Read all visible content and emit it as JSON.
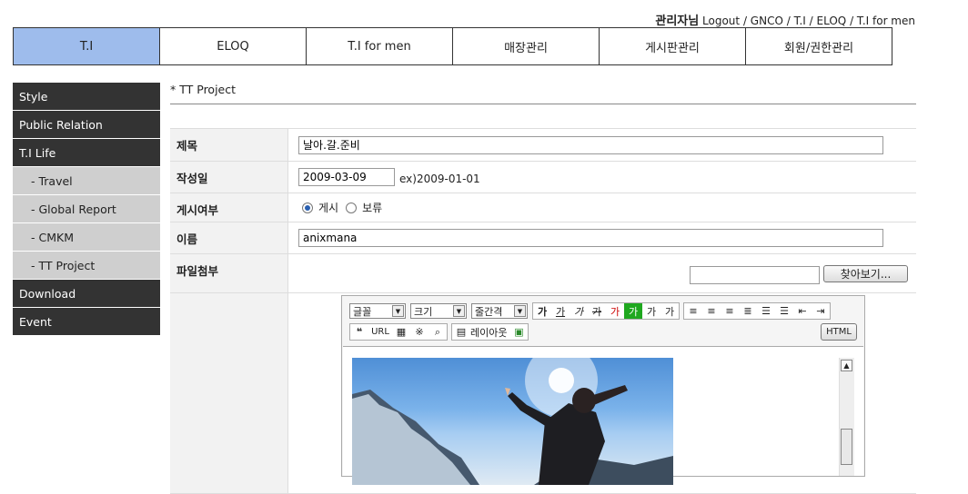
{
  "header": {
    "admin_label": "관리자님",
    "links": [
      "Logout",
      "GNCO",
      "T.I",
      "ELOQ",
      "T.I for men"
    ]
  },
  "tabs": [
    {
      "label": "T.I",
      "active": true
    },
    {
      "label": "ELOQ",
      "active": false
    },
    {
      "label": "T.I for men",
      "active": false
    },
    {
      "label": "매장관리",
      "active": false
    },
    {
      "label": "게시판관리",
      "active": false
    },
    {
      "label": "회원/권한관리",
      "active": false
    }
  ],
  "sidebar": {
    "items": [
      {
        "label": "Style",
        "type": "main"
      },
      {
        "label": "Public Relation",
        "type": "main"
      },
      {
        "label": "T.I Life",
        "type": "main"
      },
      {
        "label": "- Travel",
        "type": "sub"
      },
      {
        "label": "- Global Report",
        "type": "sub"
      },
      {
        "label": "- CMKM",
        "type": "sub"
      },
      {
        "label": "- TT Project",
        "type": "sub"
      },
      {
        "label": "Download",
        "type": "main"
      },
      {
        "label": "Event",
        "type": "main"
      }
    ]
  },
  "page": {
    "breadcrumb": "* TT Project"
  },
  "form": {
    "title_label": "제목",
    "title_value": "날아.갈.준비",
    "date_label": "작성일",
    "date_value": "2009-03-09",
    "date_hint": "ex)2009-01-01",
    "publish_label": "게시여부",
    "publish_on": "게시",
    "publish_off": "보류",
    "name_label": "이름",
    "name_value": "anixmana",
    "file_label": "파일첨부",
    "browse_label": "찾아보기..."
  },
  "editor": {
    "font_select": "글꼴",
    "size_select": "크기",
    "line_select": "줄간격",
    "format_buttons": [
      "가",
      "가",
      "가",
      "가",
      "가",
      "가",
      "가",
      "가"
    ],
    "url_label": "URL",
    "layout_label": "레이아웃",
    "html_label": "HTML"
  }
}
